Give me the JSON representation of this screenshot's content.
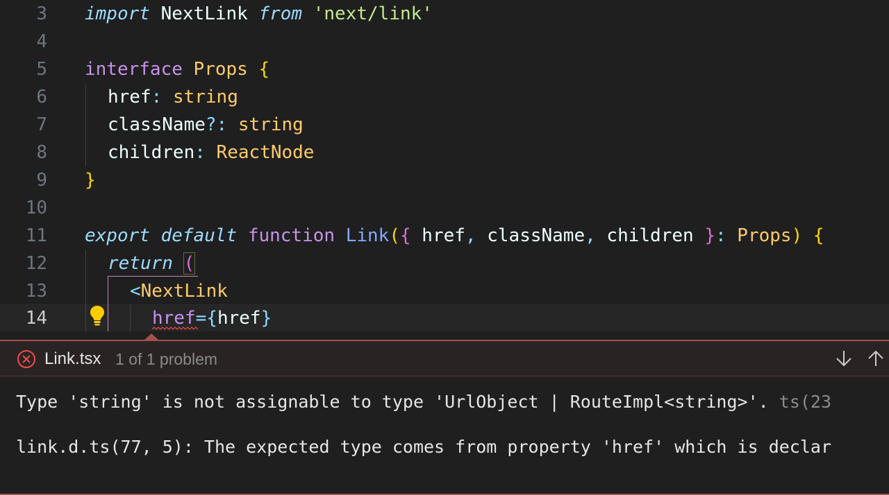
{
  "editor": {
    "lines": [
      {
        "num": "3"
      },
      {
        "num": "4"
      },
      {
        "num": "5"
      },
      {
        "num": "6"
      },
      {
        "num": "7"
      },
      {
        "num": "8"
      },
      {
        "num": "9"
      },
      {
        "num": "10"
      },
      {
        "num": "11"
      },
      {
        "num": "12"
      },
      {
        "num": "13"
      },
      {
        "num": "14"
      }
    ],
    "code": {
      "l3": [
        "import",
        " NextLink ",
        "from",
        " ",
        "'next/link'"
      ],
      "l5": [
        "interface",
        " ",
        "Props",
        " ",
        "{"
      ],
      "l6": [
        "href",
        ": ",
        "string"
      ],
      "l7": [
        "className",
        "?: ",
        "string"
      ],
      "l8": [
        "children",
        ": ",
        "ReactNode"
      ],
      "l9": [
        "}"
      ],
      "l11": [
        "export",
        " ",
        "default",
        " ",
        "function",
        " ",
        "Link",
        "(",
        "{",
        " href",
        ",",
        " className",
        ",",
        " children ",
        "}",
        ": ",
        "Props",
        ")",
        " ",
        "{"
      ],
      "l12": [
        "return",
        " ",
        "("
      ],
      "l13": [
        "<",
        "NextLink"
      ],
      "l14": [
        "href",
        "=",
        "{",
        "href",
        "}"
      ]
    },
    "lightbulb_icon": "lightbulb-icon"
  },
  "problem_peek": {
    "file": "Link.tsx",
    "count": "1 of 1 problem",
    "message_main": "Type 'string' is not assignable to type 'UrlObject | RouteImpl<string>'.",
    "message_code": "ts(23",
    "related": "link.d.ts(77, 5): The expected type comes from property 'href' which is declar",
    "icons": {
      "error": "error-circle-icon",
      "next": "arrow-down-icon",
      "prev": "arrow-up-icon"
    },
    "colors": {
      "border": "#a0514c",
      "error": "#f14c4c"
    }
  }
}
